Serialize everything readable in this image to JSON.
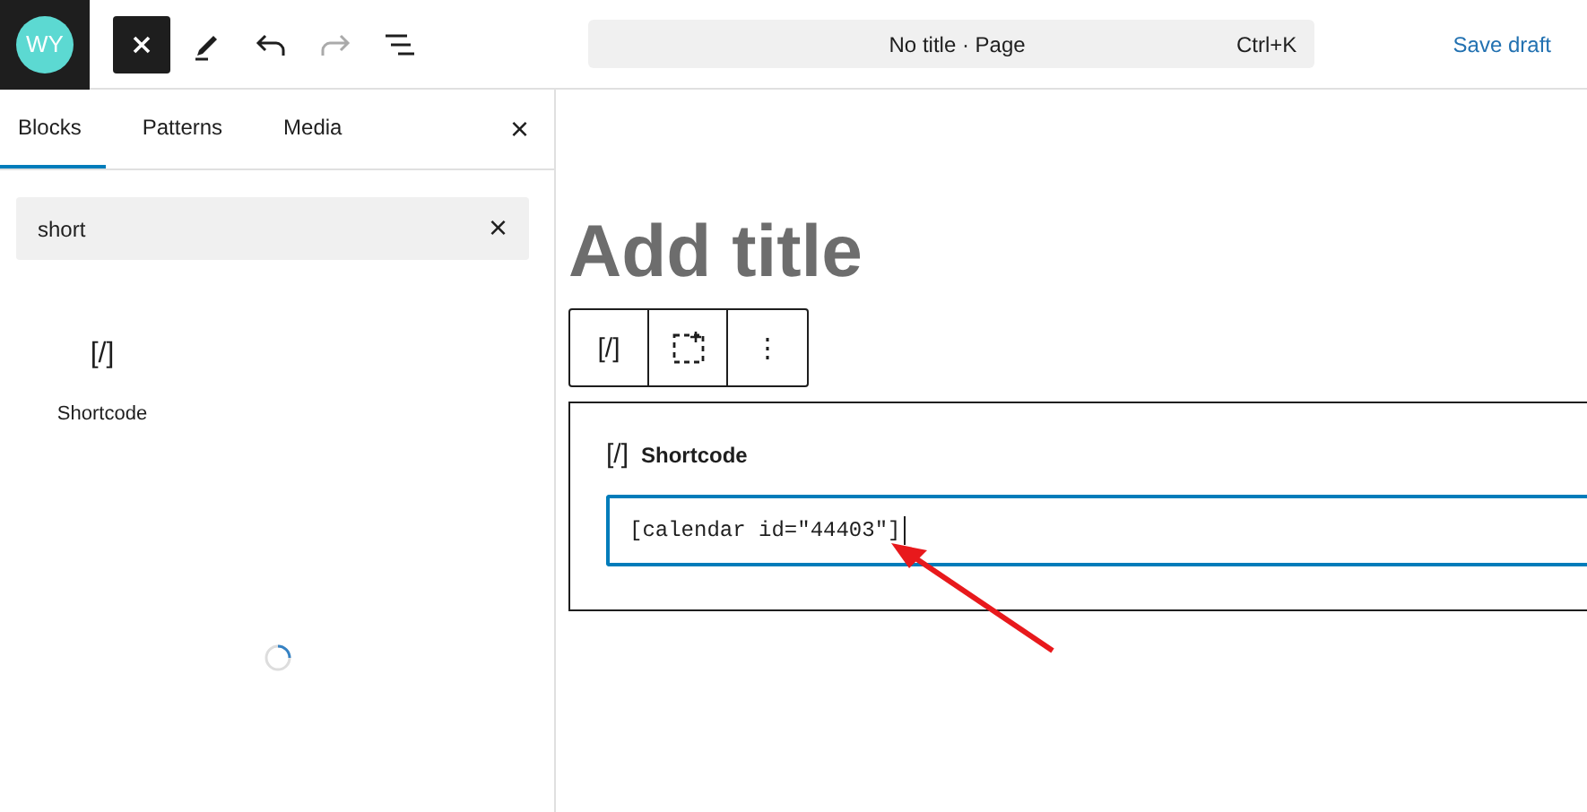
{
  "logo": {
    "text": "WY"
  },
  "toolbar": [
    {
      "kind": "close"
    },
    {
      "kind": "edit"
    },
    {
      "kind": "undo"
    },
    {
      "kind": "redo",
      "disabled": true
    },
    {
      "kind": "outline"
    }
  ],
  "command_bar": {
    "title": "No title · Page",
    "shortcut": "Ctrl+K"
  },
  "save_draft": "Save draft",
  "inserter": {
    "tabs": [
      {
        "label": "Blocks",
        "selected": true
      },
      {
        "label": "Patterns",
        "selected": false
      },
      {
        "label": "Media",
        "selected": false
      }
    ],
    "close": "×",
    "search": {
      "value": "short",
      "clear": "×"
    },
    "results": [
      {
        "icon": "[/]",
        "label": "Shortcode"
      }
    ]
  },
  "editor": {
    "title_placeholder": "Add title",
    "block_toolbar": [
      {
        "kind": "glyph",
        "text": "[/]"
      },
      {
        "kind": "move"
      },
      {
        "kind": "more",
        "text": "⋮"
      }
    ],
    "block": {
      "icon": "[/]",
      "label": "Shortcode",
      "value": "[calendar id=\"44403\"]"
    }
  }
}
